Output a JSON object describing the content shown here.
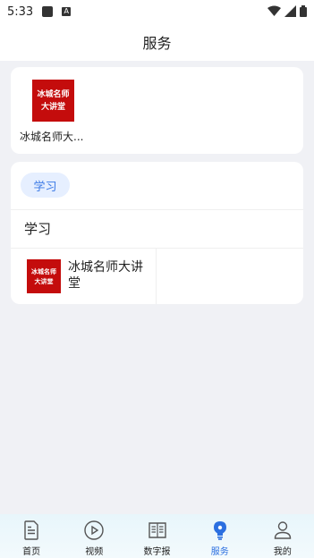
{
  "status_bar": {
    "time": "5:33",
    "a_badge": "A"
  },
  "header": {
    "title": "服务"
  },
  "featured": {
    "apps": [
      {
        "name": "冰城名师大...",
        "logo_line1": "冰城名师",
        "logo_line2": "大讲堂",
        "logo_color": "#c40c0c"
      }
    ]
  },
  "category": {
    "chip": "学习",
    "section_title": "学习",
    "items": [
      {
        "name": "冰城名师大讲堂",
        "logo_line1": "冰城名师",
        "logo_line2": "大讲堂"
      }
    ]
  },
  "tabbar": {
    "active_color": "#2b6fe0",
    "tabs": [
      {
        "label": "首页",
        "icon": "home-doc-icon",
        "active": false
      },
      {
        "label": "视频",
        "icon": "play-icon",
        "active": false
      },
      {
        "label": "数字报",
        "icon": "newspaper-icon",
        "active": false
      },
      {
        "label": "服务",
        "icon": "bulb-icon",
        "active": true
      },
      {
        "label": "我的",
        "icon": "user-icon",
        "active": false
      }
    ]
  }
}
